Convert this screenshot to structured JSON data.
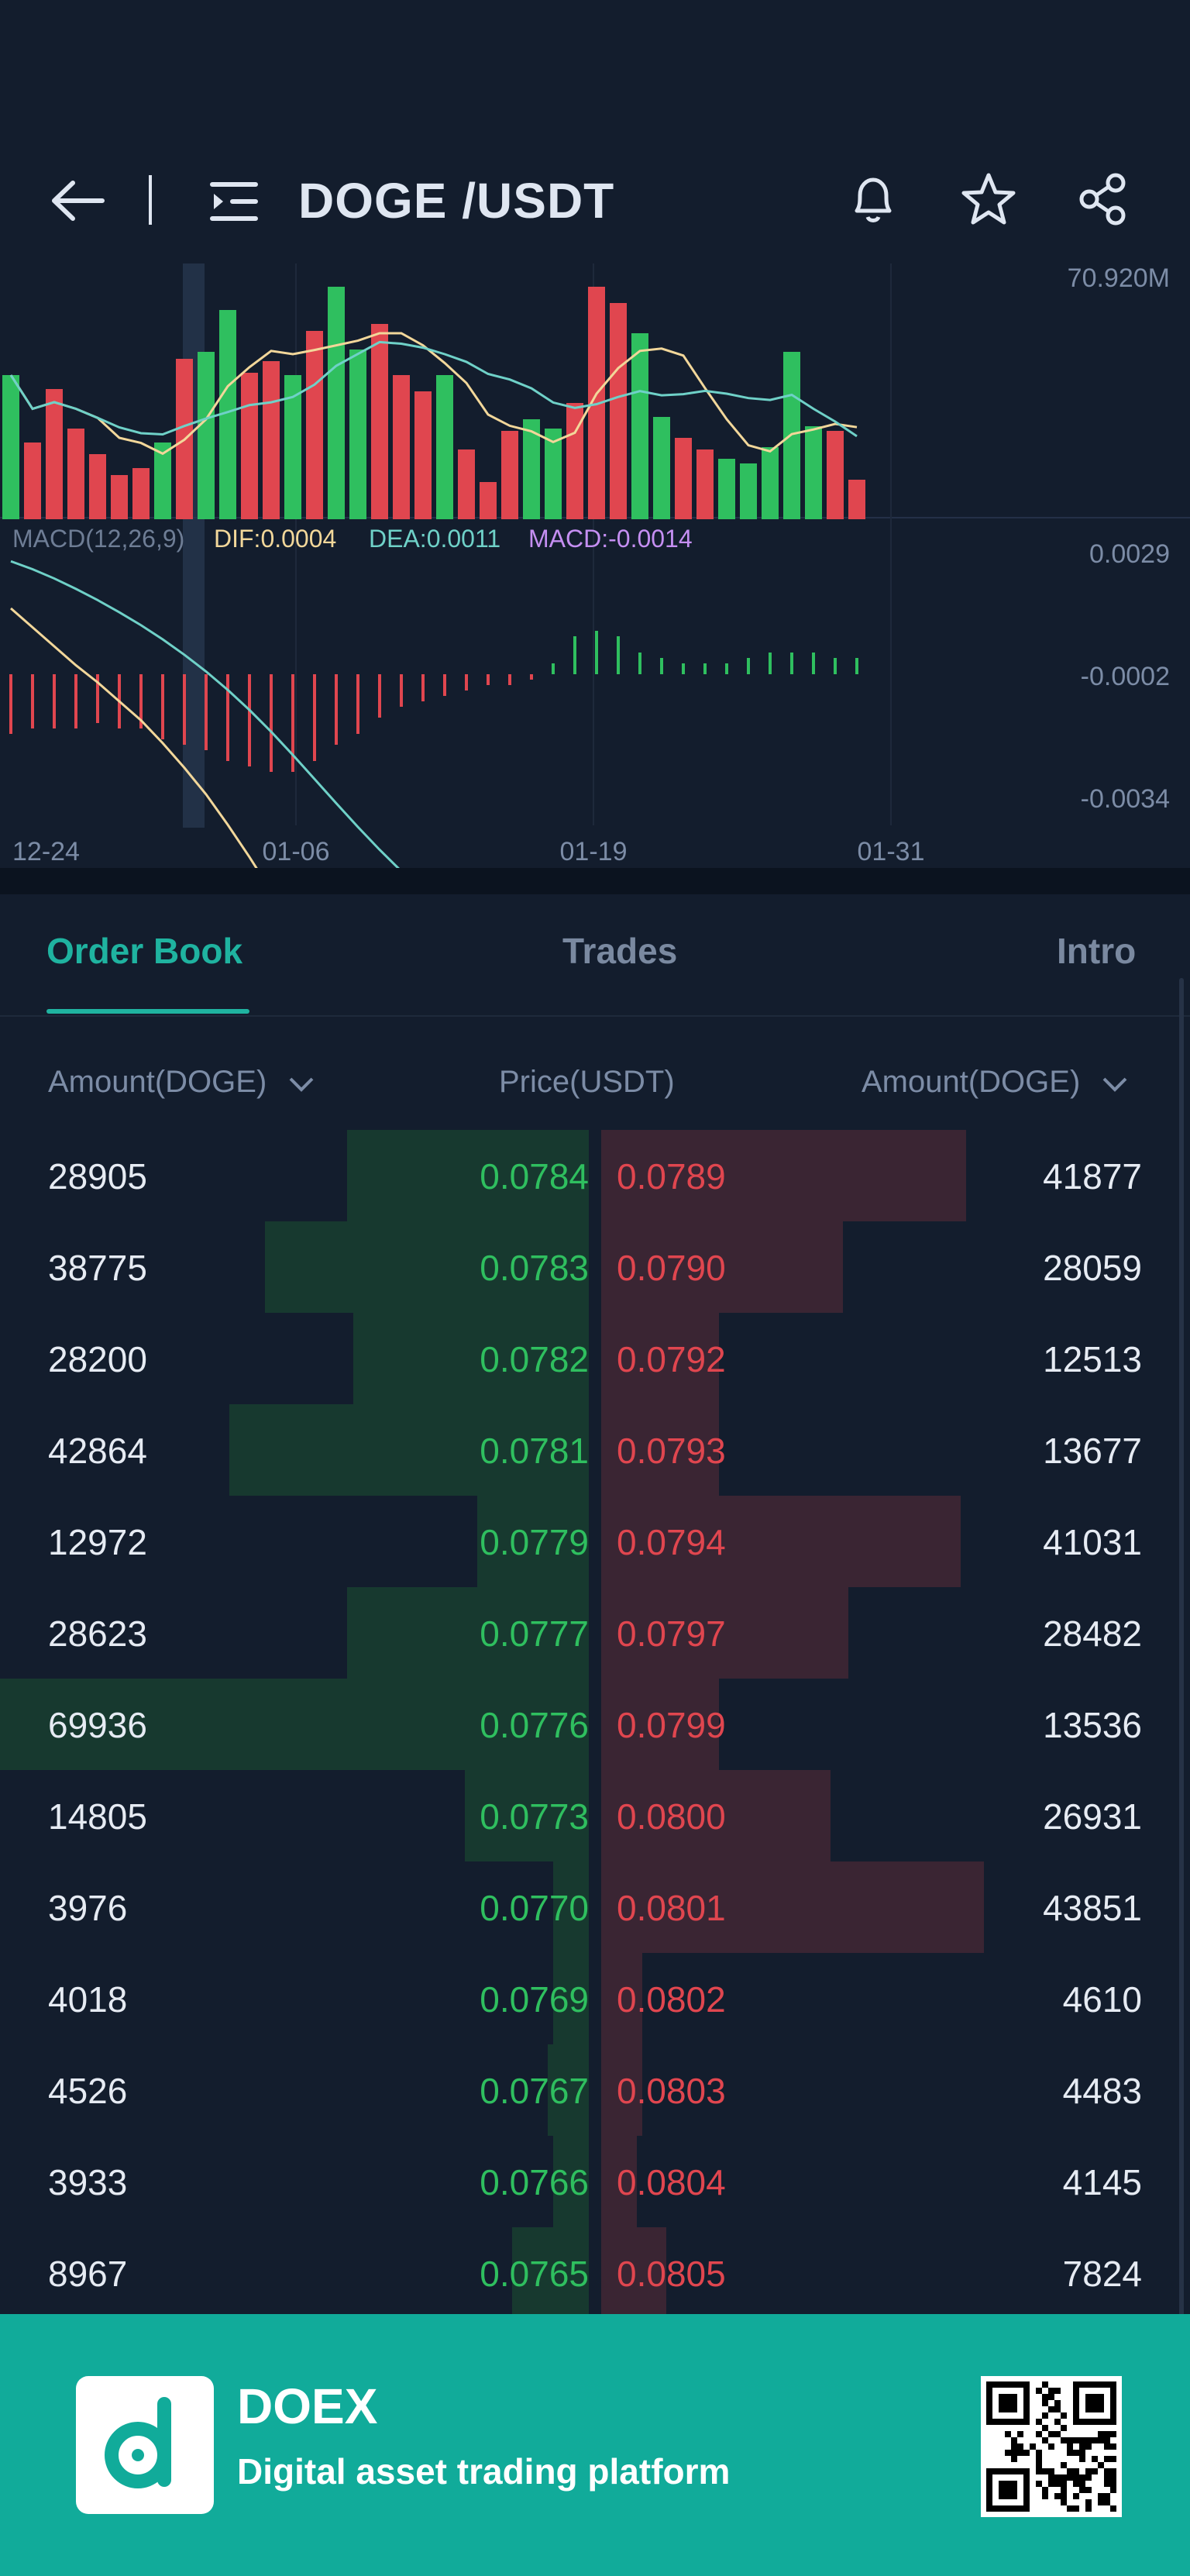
{
  "header": {
    "pair_title": "DOGE /USDT",
    "icons": [
      "back-arrow-icon",
      "menu-list-icon",
      "bell-icon",
      "star-icon",
      "share-icon"
    ]
  },
  "chart": {
    "volume_label": "70.920M",
    "macd_label": "MACD(12,26,9)",
    "dif_label": "DIF:0.0004",
    "dea_label": "DEA:0.0011",
    "macd_value_label": "MACD:-0.0014",
    "macd_axis": [
      "0.0029",
      "-0.0002",
      "-0.0034"
    ],
    "dates": [
      "12-24",
      "01-06",
      "01-19",
      "01-31"
    ],
    "colors": {
      "up": "#2fbf5f",
      "down": "#e0464f",
      "dif": "#f2d79a",
      "dea": "#6fd1c8",
      "macd_text": "#c58ff2"
    }
  },
  "chart_data": [
    {
      "type": "bar",
      "title": "",
      "volume_series": {
        "up": [
          1,
          0,
          0,
          0,
          0,
          0,
          0,
          1,
          0,
          1,
          1,
          0,
          0,
          1,
          0,
          1,
          1,
          0,
          0,
          0,
          1,
          0,
          0,
          0,
          1,
          1,
          0,
          0,
          0,
          1,
          1,
          0,
          0,
          1,
          1,
          1,
          1,
          1,
          0,
          0
        ],
        "values": [
          62,
          33,
          56,
          39,
          28,
          19,
          22,
          33,
          69,
          72,
          90,
          63,
          68,
          62,
          81,
          100,
          73,
          84,
          62,
          55,
          62,
          30,
          16,
          38,
          43,
          39,
          50,
          100,
          93,
          80,
          44,
          35,
          30,
          26,
          24,
          31,
          72,
          40,
          38,
          17
        ]
      },
      "macd_histogram": [
        -0.0011,
        -0.001,
        -0.001,
        -0.001,
        -0.0009,
        -0.001,
        -0.001,
        -0.0012,
        -0.0013,
        -0.0014,
        -0.0016,
        -0.0017,
        -0.0018,
        -0.0018,
        -0.0016,
        -0.0013,
        -0.0011,
        -0.0008,
        -0.0006,
        -0.0005,
        -0.0004,
        -0.0003,
        -0.0002,
        -0.0002,
        -0.0001,
        0.0002,
        0.0007,
        0.0008,
        0.0007,
        0.0004,
        0.0003,
        0.0002,
        0.0002,
        0.0002,
        0.0003,
        0.0004,
        0.0004,
        0.0004,
        0.0003,
        0.0003
      ]
    }
  ],
  "tabs": [
    {
      "label": "Order Book",
      "active": true
    },
    {
      "label": "Trades",
      "active": false
    },
    {
      "label": "Intro",
      "active": false
    }
  ],
  "orderbook_header": {
    "bid_amount": "Amount(DOGE)",
    "price": "Price(USDT)",
    "ask_amount": "Amount(DOGE)"
  },
  "orderbook_rows": [
    {
      "bid_amt": "28905",
      "bid_px": "0.0784",
      "ask_px": "0.0789",
      "ask_amt": "41877",
      "bid_depth": 0.41,
      "ask_depth": 0.62
    },
    {
      "bid_amt": "38775",
      "bid_px": "0.0783",
      "ask_px": "0.0790",
      "ask_amt": "28059",
      "bid_depth": 0.55,
      "ask_depth": 0.41
    },
    {
      "bid_amt": "28200",
      "bid_px": "0.0782",
      "ask_px": "0.0792",
      "ask_amt": "12513",
      "bid_depth": 0.4,
      "ask_depth": 0.2
    },
    {
      "bid_amt": "42864",
      "bid_px": "0.0781",
      "ask_px": "0.0793",
      "ask_amt": "13677",
      "bid_depth": 0.61,
      "ask_depth": 0.2
    },
    {
      "bid_amt": "12972",
      "bid_px": "0.0779",
      "ask_px": "0.0794",
      "ask_amt": "41031",
      "bid_depth": 0.19,
      "ask_depth": 0.61
    },
    {
      "bid_amt": "28623",
      "bid_px": "0.0777",
      "ask_px": "0.0797",
      "ask_amt": "28482",
      "bid_depth": 0.41,
      "ask_depth": 0.42
    },
    {
      "bid_amt": "69936",
      "bid_px": "0.0776",
      "ask_px": "0.0799",
      "ask_amt": "13536",
      "bid_depth": 1.0,
      "ask_depth": 0.2
    },
    {
      "bid_amt": "14805",
      "bid_px": "0.0773",
      "ask_px": "0.0800",
      "ask_amt": "26931",
      "bid_depth": 0.21,
      "ask_depth": 0.39
    },
    {
      "bid_amt": "3976",
      "bid_px": "0.0770",
      "ask_px": "0.0801",
      "ask_amt": "43851",
      "bid_depth": 0.06,
      "ask_depth": 0.65
    },
    {
      "bid_amt": "4018",
      "bid_px": "0.0769",
      "ask_px": "0.0802",
      "ask_amt": "4610",
      "bid_depth": 0.06,
      "ask_depth": 0.07
    },
    {
      "bid_amt": "4526",
      "bid_px": "0.0767",
      "ask_px": "0.0803",
      "ask_amt": "4483",
      "bid_depth": 0.07,
      "ask_depth": 0.07
    },
    {
      "bid_amt": "3933",
      "bid_px": "0.0766",
      "ask_px": "0.0804",
      "ask_amt": "4145",
      "bid_depth": 0.06,
      "ask_depth": 0.06
    },
    {
      "bid_amt": "8967",
      "bid_px": "0.0765",
      "ask_px": "0.0805",
      "ask_amt": "7824",
      "bid_depth": 0.13,
      "ask_depth": 0.11
    }
  ],
  "banner": {
    "brand": "DOEX",
    "tagline": "Digital asset trading platform",
    "background": "#11ab9a"
  }
}
